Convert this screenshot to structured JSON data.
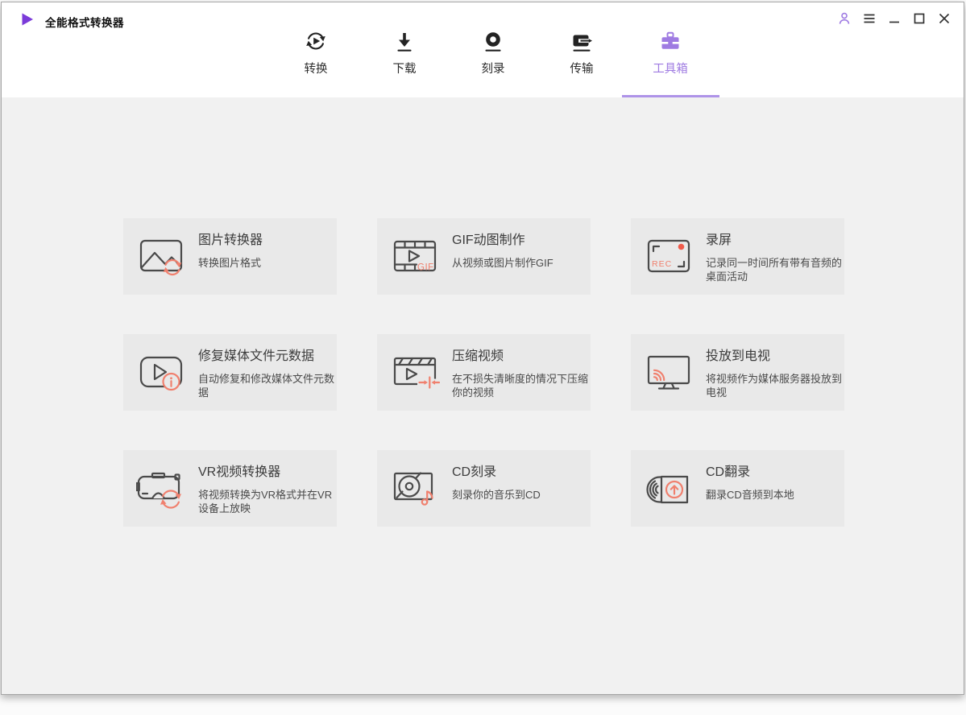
{
  "window": {
    "title": "全能格式转换器",
    "logo_icon": "play-logo-icon"
  },
  "titlebar_controls": {
    "account_icon": "account-icon",
    "menu_icon": "menu-icon",
    "minimize_icon": "minimize-icon",
    "maximize_icon": "maximize-icon",
    "close_icon": "close-icon"
  },
  "nav": {
    "tabs": [
      {
        "label": "转换",
        "icon": "convert-icon",
        "active": false
      },
      {
        "label": "下载",
        "icon": "download-icon",
        "active": false
      },
      {
        "label": "刻录",
        "icon": "burn-icon",
        "active": false
      },
      {
        "label": "传输",
        "icon": "transfer-icon",
        "active": false
      },
      {
        "label": "工具箱",
        "icon": "toolbox-icon",
        "active": true
      }
    ]
  },
  "toolbox": {
    "cards": [
      {
        "title": "图片转换器",
        "desc": "转换图片格式",
        "icon": "image-converter-icon"
      },
      {
        "title": "GIF动图制作",
        "desc": "从视频或图片制作GIF",
        "icon": "gif-maker-icon"
      },
      {
        "title": "录屏",
        "desc": "记录同一时间所有带有音频的桌面活动",
        "icon": "screen-recorder-icon"
      },
      {
        "title": "修复媒体文件元数据",
        "desc": "自动修复和修改媒体文件元数据",
        "icon": "fix-metadata-icon"
      },
      {
        "title": "压缩视频",
        "desc": "在不损失清晰度的情况下压缩你的视频",
        "icon": "compress-video-icon"
      },
      {
        "title": "投放到电视",
        "desc": "将视频作为媒体服务器投放到电视",
        "icon": "cast-to-tv-icon"
      },
      {
        "title": "VR视频转换器",
        "desc": "将视频转换为VR格式并在VR设备上放映",
        "icon": "vr-converter-icon"
      },
      {
        "title": "CD刻录",
        "desc": "刻录你的音乐到CD",
        "icon": "cd-burner-icon"
      },
      {
        "title": "CD翻录",
        "desc": "翻录CD音频到本地",
        "icon": "cd-ripper-icon"
      }
    ],
    "icon_texts": {
      "gif_label": "GIF",
      "rec_label": "REC"
    }
  },
  "colors": {
    "accent_purple": "#9F7BE2",
    "underline_purple": "#AE93E8",
    "logo_purple": "#7B3BD9",
    "accent_salmon": "#F0806E",
    "record_red": "#EF5B4B",
    "icon_stroke": "#4A4A4A",
    "header_bg": "#FFFFFF",
    "content_bg": "#F1F1F1",
    "card_bg": "#E9E9E9"
  }
}
